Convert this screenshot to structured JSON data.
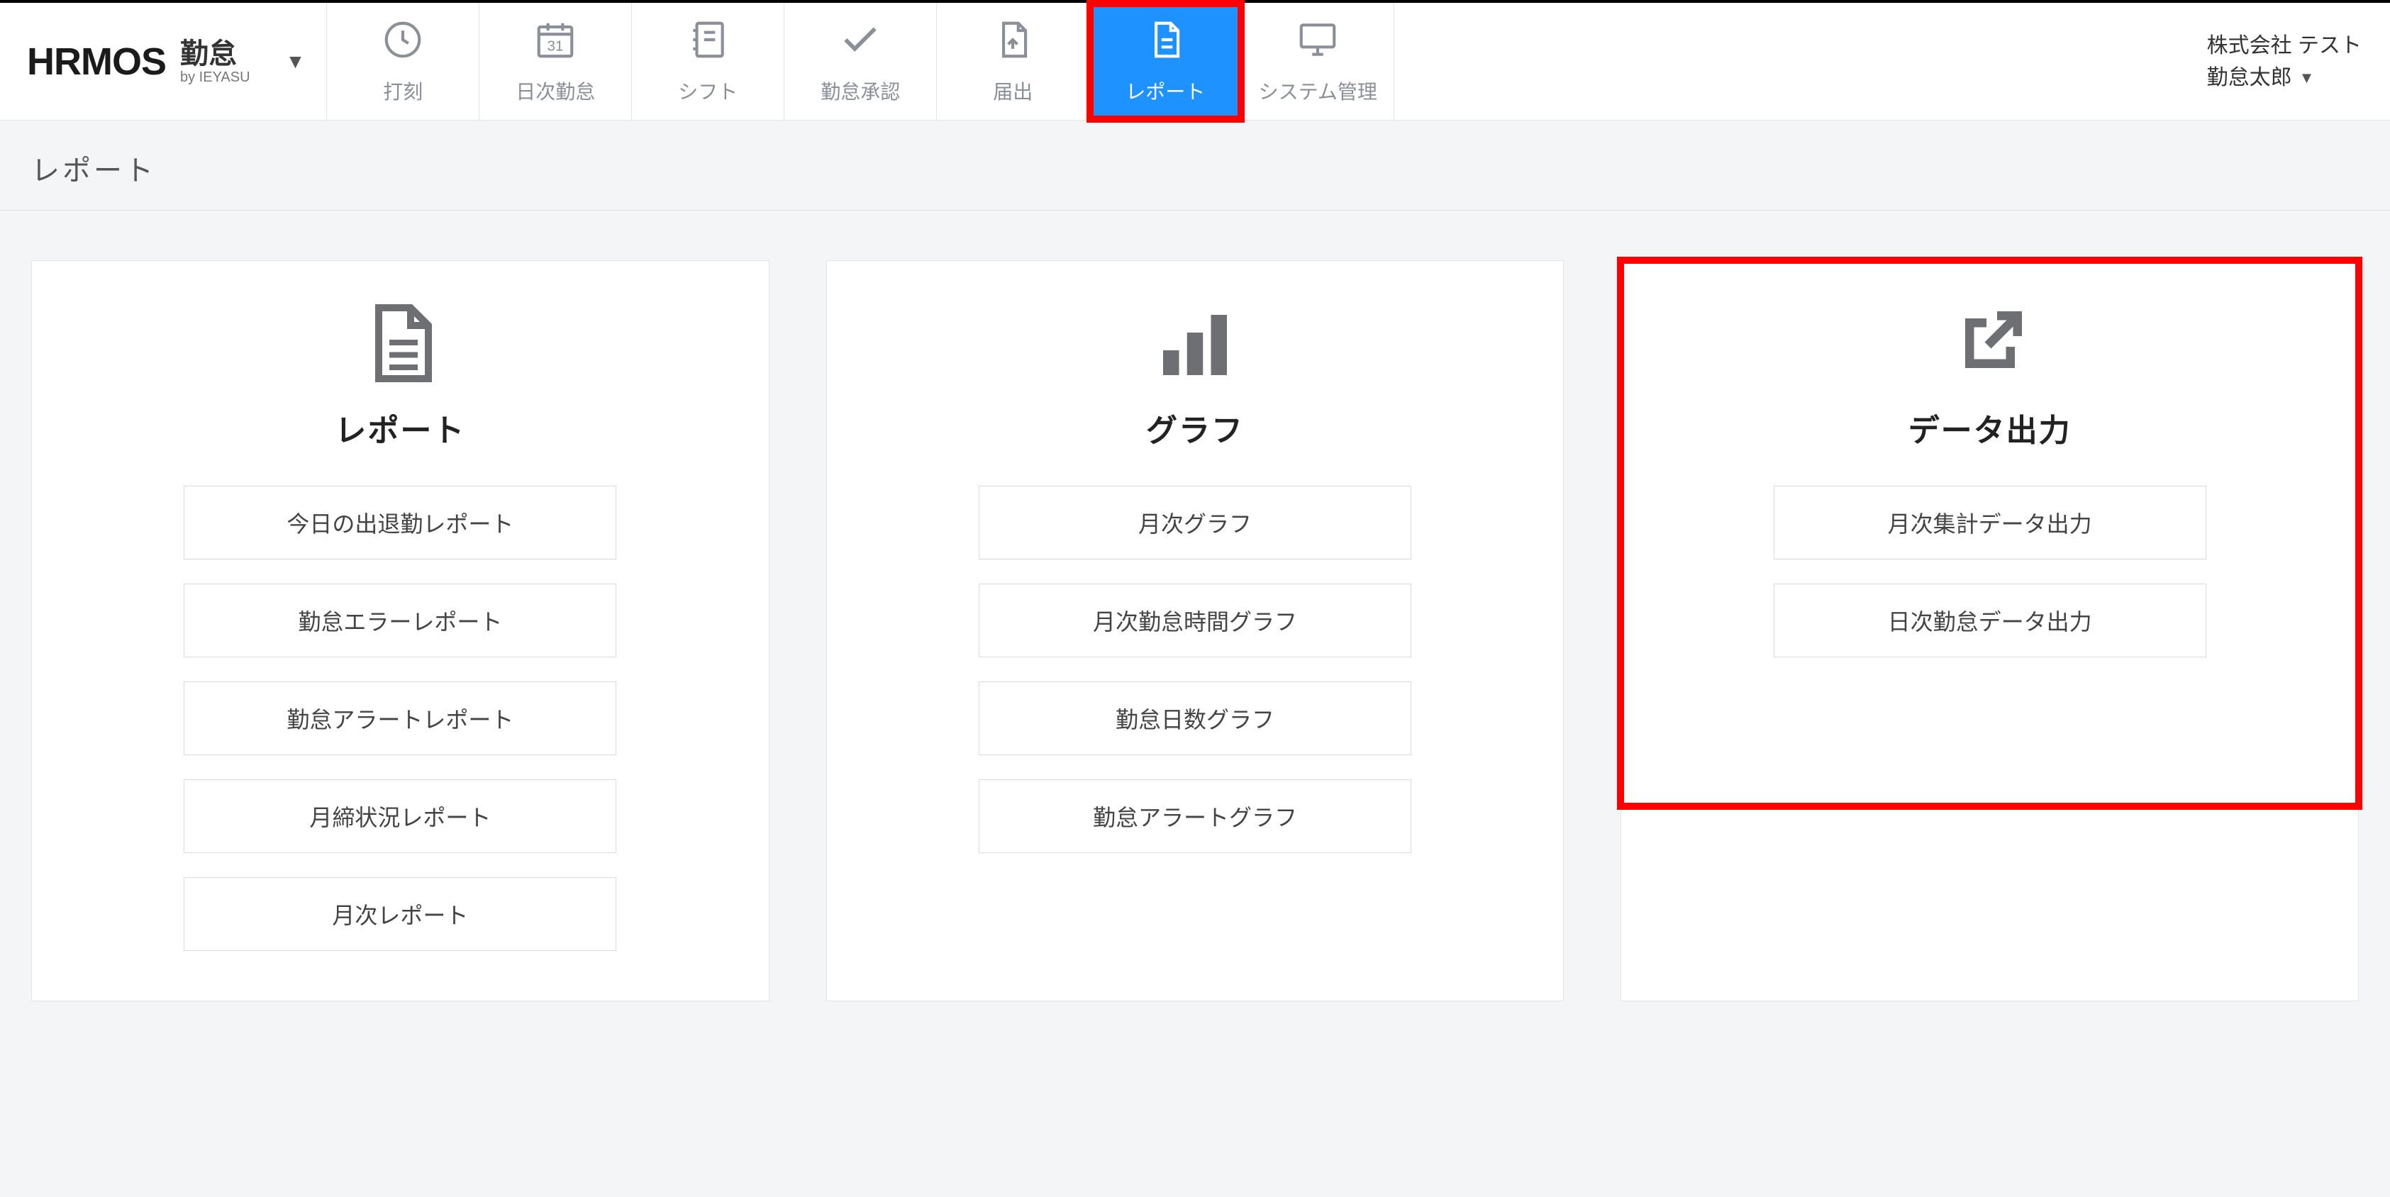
{
  "logo": {
    "main": "HRMOS",
    "sub_big": "勤怠",
    "sub_small": "by IEYASU"
  },
  "nav": [
    {
      "label": "打刻",
      "icon": "clock"
    },
    {
      "label": "日次勤怠",
      "icon": "calendar"
    },
    {
      "label": "シフト",
      "icon": "notebook"
    },
    {
      "label": "勤怠承認",
      "icon": "check"
    },
    {
      "label": "届出",
      "icon": "file-up"
    },
    {
      "label": "レポート",
      "icon": "file",
      "active": true,
      "highlight": true
    },
    {
      "label": "システム管理",
      "icon": "monitor"
    }
  ],
  "user": {
    "company": "株式会社 テスト",
    "name": "勤怠太郎"
  },
  "page_title": "レポート",
  "cards": [
    {
      "title": "レポート",
      "icon": "doc",
      "links": [
        "今日の出退勤レポート",
        "勤怠エラーレポート",
        "勤怠アラートレポート",
        "月締状況レポート",
        "月次レポート"
      ]
    },
    {
      "title": "グラフ",
      "icon": "bars",
      "links": [
        "月次グラフ",
        "月次勤怠時間グラフ",
        "勤怠日数グラフ",
        "勤怠アラートグラフ"
      ]
    },
    {
      "title": "データ出力",
      "icon": "export",
      "highlight_top": true,
      "links": [
        "月次集計データ出力",
        "日次勤怠データ出力"
      ]
    }
  ]
}
